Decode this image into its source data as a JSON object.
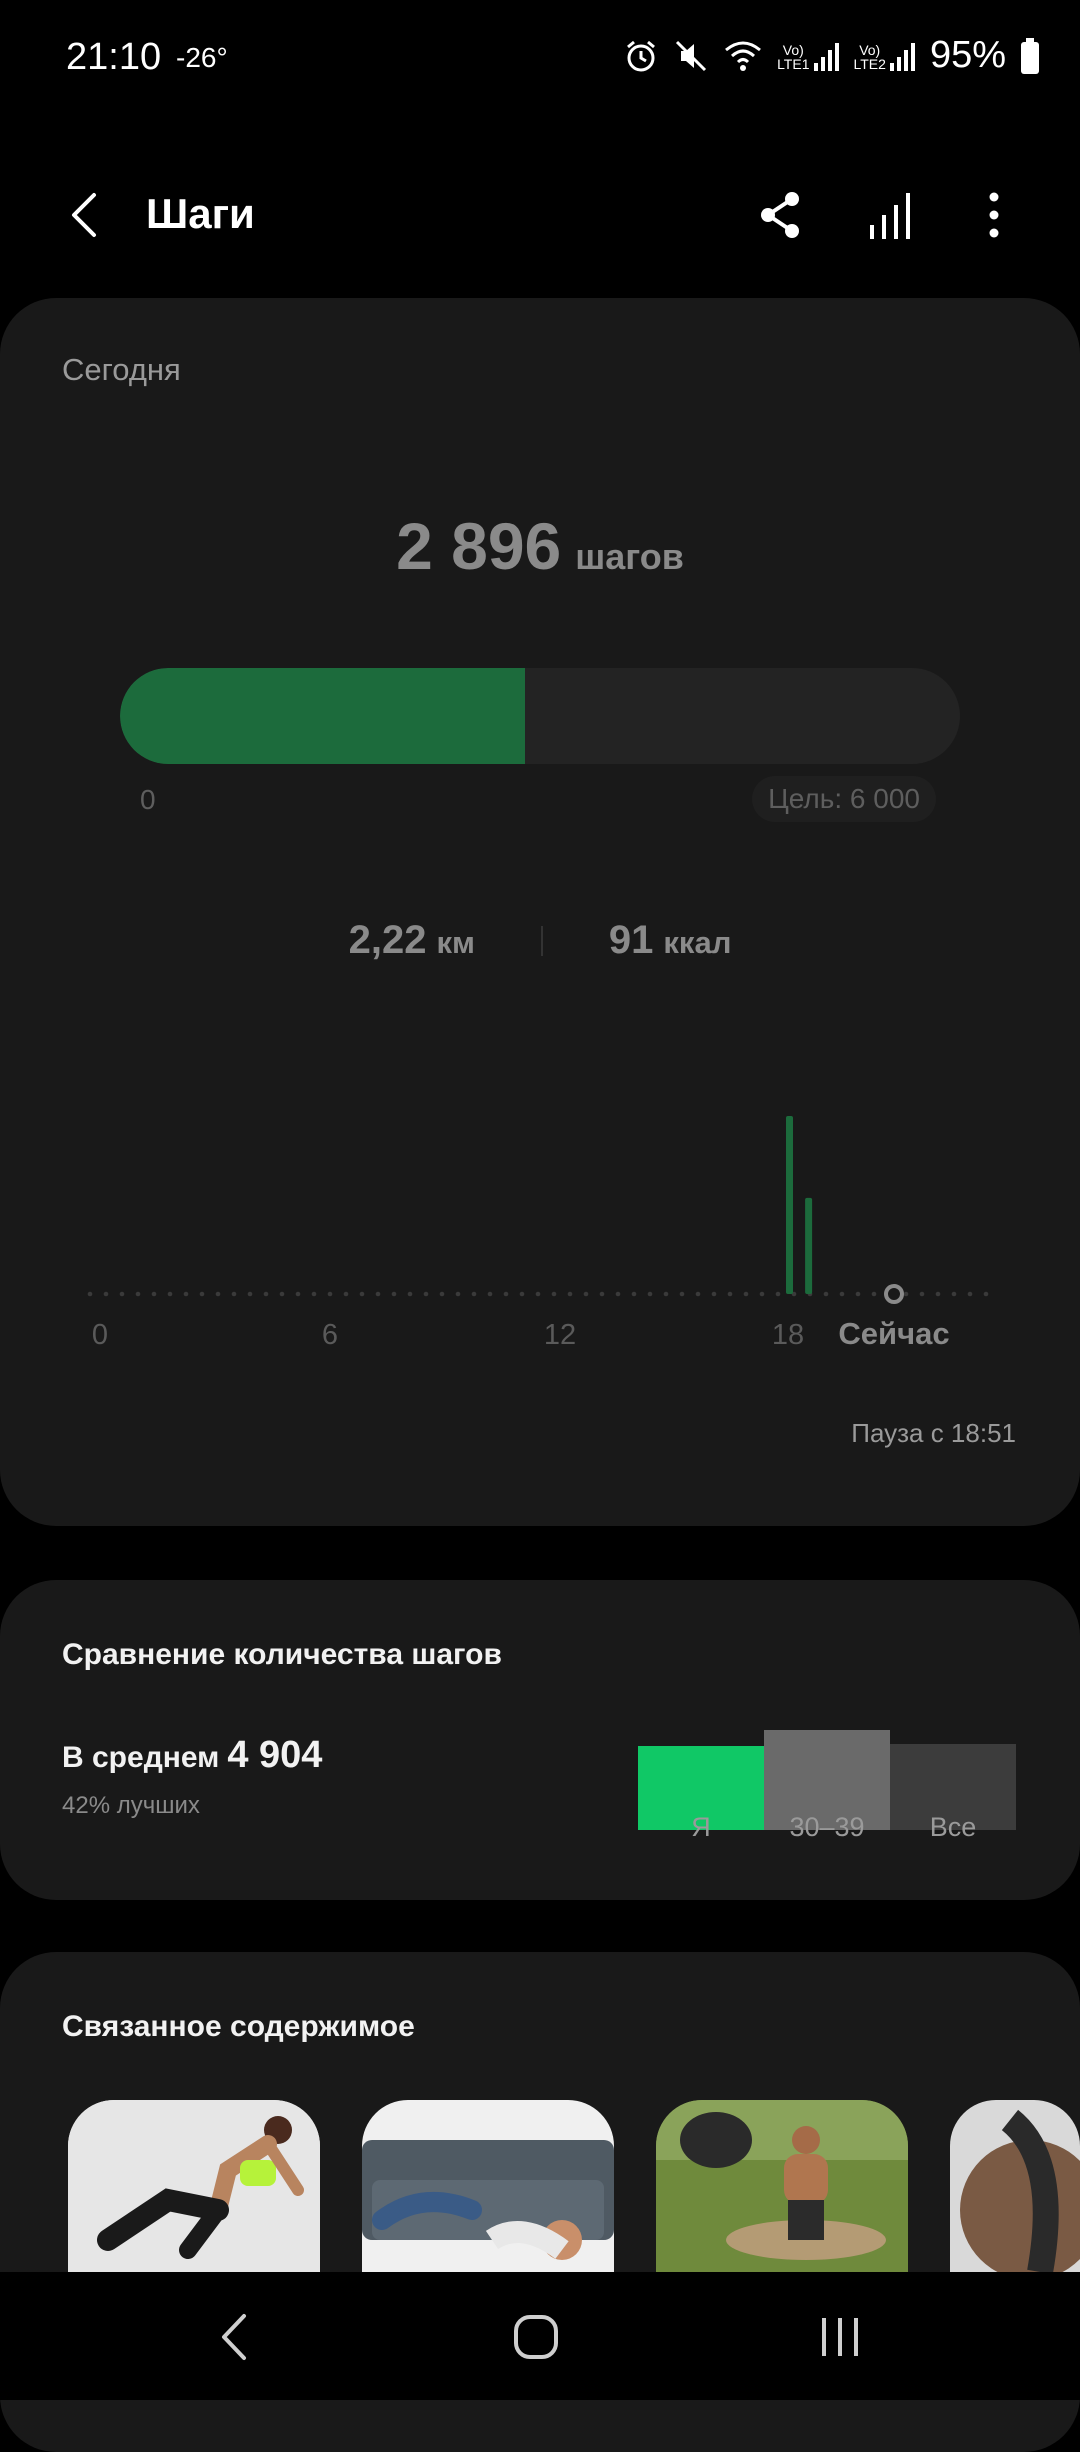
{
  "status_bar": {
    "time": "21:10",
    "temperature": "-26°",
    "net1": "LTE1",
    "net2": "LTE2",
    "battery": "95%"
  },
  "appbar": {
    "title": "Шаги",
    "icons": [
      "back-icon",
      "share-icon",
      "trends-icon",
      "more-icon"
    ]
  },
  "today": {
    "label": "Сегодня",
    "steps": "2 896",
    "steps_unit": "шагов",
    "progress": 0.4827,
    "progress_min": "0",
    "goal": "Цель: 6 000",
    "distance": "2,22",
    "distance_unit": "км",
    "calories": "91",
    "calories_unit": "ккал",
    "pause": "Пауза с 18:51"
  },
  "chart_data": {
    "type": "bar",
    "x_ticks": [
      "0",
      "6",
      "12",
      "18",
      "Сейчас"
    ],
    "x_range_hours": [
      0,
      24
    ],
    "bars": [
      {
        "hour": 18.0,
        "value": 1.0
      },
      {
        "hour": 18.5,
        "value": 0.54
      }
    ],
    "now_hour": 21.17,
    "colors": {
      "bar": "#1c6b3c",
      "axis": "#3a3a3a",
      "now": "#8a8a8a"
    }
  },
  "comparison": {
    "title": "Сравнение количества шагов",
    "avg_label": "В среднем",
    "avg_value": "4 904",
    "better": "42% лучших",
    "bars": [
      {
        "label": "Я",
        "value": 0.84,
        "color": "#10c866"
      },
      {
        "label": "30–39",
        "value": 1.0,
        "color": "#6a6a6a"
      },
      {
        "label": "Все",
        "value": 0.86,
        "color": "#3c3c3c"
      }
    ]
  },
  "related": {
    "title": "Связанное содержимое"
  },
  "navbar": {
    "icons": [
      "nav-back-icon",
      "home-icon",
      "recents-icon"
    ]
  }
}
